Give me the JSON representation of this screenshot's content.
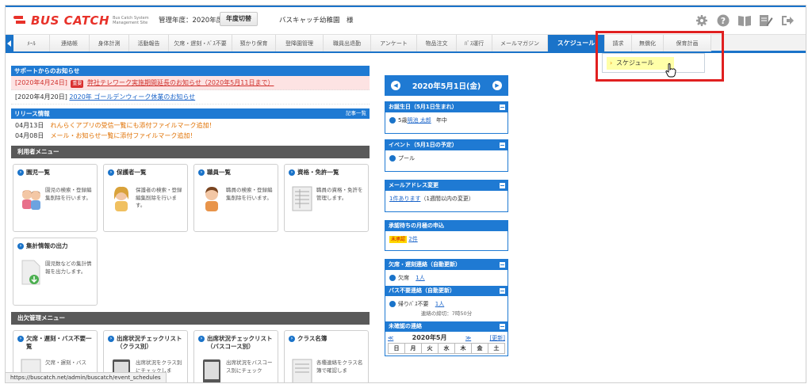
{
  "header": {
    "logo_text": "BUS CATCH",
    "logo_sub": "Bus Catch System Management Site",
    "year_label": "管理年度：2020年度",
    "year_button": "年度切替",
    "school": "バスキャッチ幼稚園　様"
  },
  "nav": {
    "items": [
      "ﾒｰﾙ",
      "連絡帳",
      "身体計測",
      "活動報告",
      "欠席・遅刻・ﾊﾞｽ不要",
      "預かり保育",
      "登降園管理",
      "職員出退勤",
      "アンケート",
      "物品注文",
      "ﾊﾞｽ運行",
      "メールマガジン",
      "スケジュール",
      "請求",
      "無償化",
      "保育計画"
    ],
    "active": "スケジュール",
    "dropdown_item": "スケジュール"
  },
  "support": {
    "title": "サポートからのお知らせ",
    "notices": [
      {
        "date": "[2020年4月24日]",
        "tag": "重要",
        "text": "弊社テレワーク実施期間延長のお知らせ（2020年5月11日まで）"
      },
      {
        "date": "[2020年4月20日]",
        "text": "2020年 ゴールデンウィーク休業のお知らせ"
      }
    ]
  },
  "release": {
    "title": "リリース情報",
    "more": "記事一覧",
    "items": [
      {
        "date": "04月13日",
        "text": "れんらくアプリの受信一覧にも添付ファイルマーク追加！"
      },
      {
        "date": "04月08日",
        "text": "メール・お知らせ一覧に添付ファイルマーク追加！"
      }
    ]
  },
  "user_menu": {
    "title": "利用者メニュー",
    "cards": [
      {
        "title": "園児一覧",
        "desc": "園児の検索・登録編集削除を行います。"
      },
      {
        "title": "保護者一覧",
        "desc": "保護者の検索・登録編集削除を行います。"
      },
      {
        "title": "職員一覧",
        "desc": "職員の検索・登録編集削除を行います。"
      },
      {
        "title": "資格・免許一覧",
        "desc": "職員の資格・免許を管理します。"
      },
      {
        "title": "集計情報の出力",
        "desc": "園児数などの集計情報を出力します。"
      }
    ]
  },
  "attend_menu": {
    "title": "出欠管理メニュー",
    "cards": [
      {
        "title": "欠席・遅刻・バス不要一覧",
        "desc": "欠席・遅刻・バス"
      },
      {
        "title": "出席状況チェックリスト（クラス別）",
        "desc": "出席状況をクラス別にチェックしま"
      },
      {
        "title": "出席状況チェックリスト（バスコース別）",
        "desc": "出席状況をバスコース別にチェック"
      },
      {
        "title": "クラス名簿",
        "desc": "各種連絡をクラス名簿で確認しま"
      }
    ]
  },
  "side": {
    "date": "2020年5月1日(金)",
    "birthday_title": "お誕生日（5月1日生まれ）",
    "birthday_age": "5歳",
    "birthday_name": "明池 太郎",
    "birthday_class": "年中",
    "event_title": "イベント（5月1日の予定）",
    "event_item": "プール",
    "mail_title": "メールアドレス変更",
    "mail_link": "1件あります",
    "mail_note": "（1週間以内の変更）",
    "pending_title": "承認待ちの月極の申込",
    "pending_badge": "未承認",
    "pending_link": "2件",
    "absence_title": "欠席・遅刻連絡（自動更新）",
    "absence_label": "欠席",
    "absence_link": "1人",
    "bus_title": "バス不要連絡（自動更新）",
    "bus_label": "帰りﾊﾞｽ不要",
    "bus_link": "1人",
    "deadline": "連絡の締切：7時50分",
    "unconfirmed_title": "未確認の連絡",
    "cal_prev": "≪",
    "cal_month": "2020年5月",
    "cal_next": "≫",
    "cal_refresh": "[更新]",
    "weekdays": [
      "日",
      "月",
      "火",
      "水",
      "木",
      "金",
      "土"
    ]
  },
  "statusbar": "https://buscatch.net/admin/buscatch/event_schedules"
}
